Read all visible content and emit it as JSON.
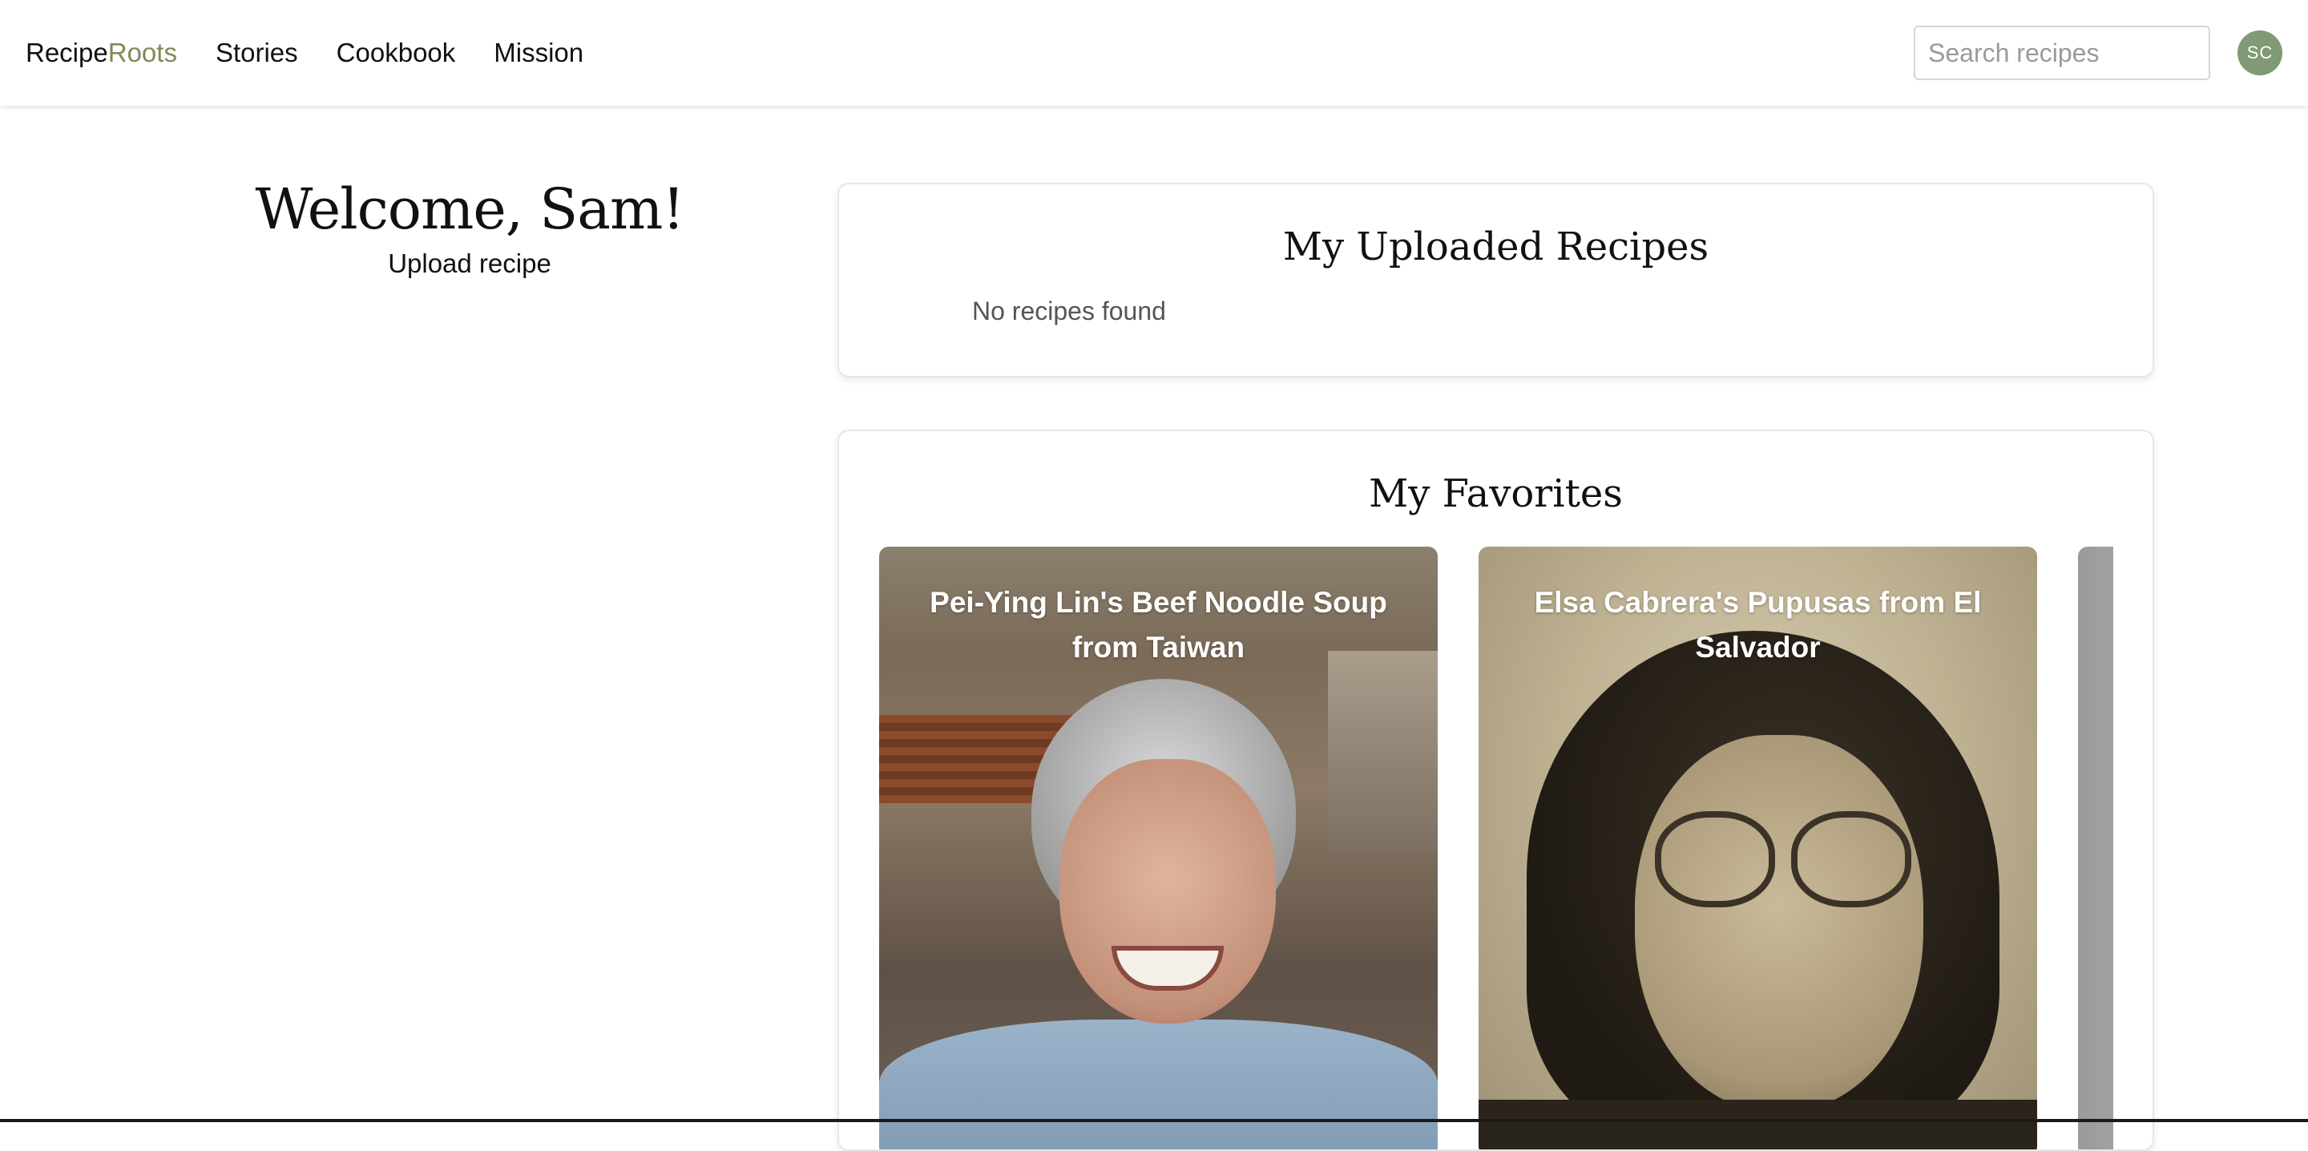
{
  "nav": {
    "brand_part1": "Recipe",
    "brand_part2": "Roots",
    "links": [
      "Stories",
      "Cookbook",
      "Mission"
    ],
    "search_placeholder": "Search recipes",
    "avatar_initials": "SC"
  },
  "sidebar": {
    "welcome": "Welcome, Sam!",
    "upload_link": "Upload recipe"
  },
  "uploaded": {
    "title": "My Uploaded Recipes",
    "empty_text": "No recipes found"
  },
  "favorites": {
    "title": "My Favorites",
    "cards": [
      {
        "title": "Pei-Ying Lin's Beef Noodle Soup from Taiwan"
      },
      {
        "title": "Elsa Cabrera's Pupusas from El Salvador"
      }
    ]
  },
  "colors": {
    "brand_accent": "#7d8b56",
    "avatar_bg": "#7f9a74"
  }
}
